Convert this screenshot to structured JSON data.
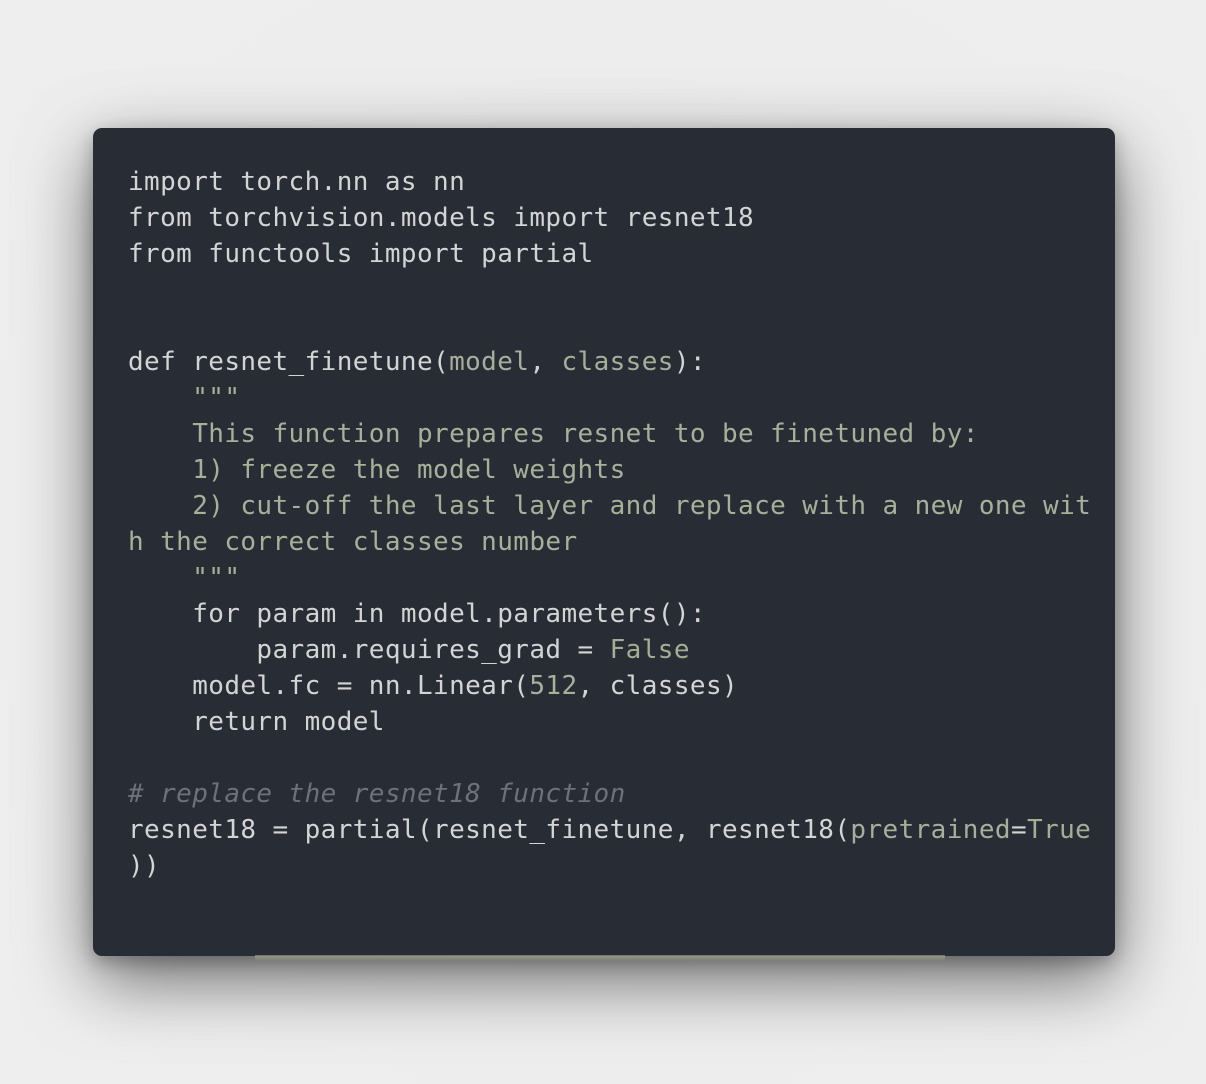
{
  "code_lines": [
    [
      {
        "t": "import torch.nn as nn",
        "k": "plain"
      }
    ],
    [
      {
        "t": "from torchvision.models import resnet18",
        "k": "plain"
      }
    ],
    [
      {
        "t": "from functools import partial",
        "k": "plain"
      }
    ],
    [],
    [],
    [
      {
        "t": "def resnet_finetune(",
        "k": "plain"
      },
      {
        "t": "model",
        "k": "param"
      },
      {
        "t": ", ",
        "k": "plain"
      },
      {
        "t": "classes",
        "k": "param"
      },
      {
        "t": "):",
        "k": "plain"
      }
    ],
    [
      {
        "t": "    \"\"\"",
        "k": "doc"
      }
    ],
    [
      {
        "t": "    This function prepares resnet to be finetuned by:",
        "k": "doc"
      }
    ],
    [
      {
        "t": "    1) freeze the model weights",
        "k": "doc"
      }
    ],
    [
      {
        "t": "    2) cut-off the last layer and replace with a new one wit",
        "k": "doc"
      }
    ],
    [
      {
        "t": "h the correct classes number",
        "k": "doc"
      }
    ],
    [
      {
        "t": "    \"\"\"",
        "k": "doc"
      }
    ],
    [
      {
        "t": "    for param in model.parameters():",
        "k": "plain"
      }
    ],
    [
      {
        "t": "        param.requires_grad = ",
        "k": "plain"
      },
      {
        "t": "False",
        "k": "const"
      }
    ],
    [
      {
        "t": "    model.fc = nn.Linear(",
        "k": "plain"
      },
      {
        "t": "512",
        "k": "num"
      },
      {
        "t": ", classes)",
        "k": "plain"
      }
    ],
    [
      {
        "t": "    return model",
        "k": "plain"
      }
    ],
    [],
    [
      {
        "t": "# replace the resnet18 function",
        "k": "comment"
      }
    ],
    [
      {
        "t": "resnet18 = partial(resnet_finetune, resnet18(",
        "k": "plain"
      },
      {
        "t": "pretrained",
        "k": "param"
      },
      {
        "t": "=",
        "k": "plain"
      },
      {
        "t": "True",
        "k": "const"
      }
    ],
    [
      {
        "t": "))",
        "k": "plain"
      }
    ]
  ],
  "colors": {
    "background": "#ececec",
    "card": "#282c35",
    "text": "#d4d4d4",
    "docstring": "#a9b09a",
    "comment": "#6c7279"
  }
}
